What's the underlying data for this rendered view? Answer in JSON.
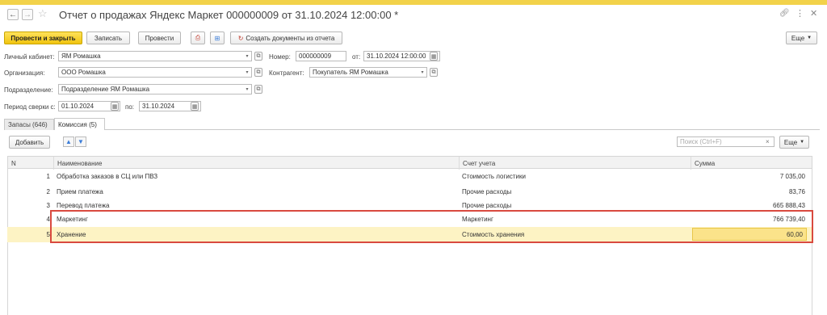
{
  "window": {
    "title": "Отчет о продажах Яндекс Маркет 000000009 от 31.10.2024 12:00:00 *"
  },
  "toolbar": {
    "post_close": "Провести и закрыть",
    "save": "Записать",
    "post": "Провести",
    "create_docs": "Создать документы из отчета",
    "more": "Еще"
  },
  "form": {
    "cabinet_label": "Личный кабинет:",
    "cabinet_value": "ЯМ Ромашка",
    "number_label": "Номер:",
    "number_value": "000000009",
    "date_label": "от:",
    "date_value": "31.10.2024 12:00:00",
    "org_label": "Организация:",
    "org_value": "ООО Ромашка",
    "contractor_label": "Контрагент:",
    "contractor_value": "Покупатель ЯМ Ромашка",
    "division_label": "Подразделение:",
    "division_value": "Подразделение ЯМ Ромашка",
    "period_label": "Период сверки с:",
    "period_from": "01.10.2024",
    "period_to_label": "по:",
    "period_to": "31.10.2024"
  },
  "tabs": [
    {
      "label": "Запасы (646)"
    },
    {
      "label": "Комиссия (5)"
    }
  ],
  "table_toolbar": {
    "add": "Добавить",
    "search_placeholder": "Поиск (Ctrl+F)",
    "more": "Еще"
  },
  "table": {
    "headers": [
      "N",
      "Наименование",
      "Счет учета",
      "Сумма"
    ],
    "rows": [
      {
        "n": "1",
        "name": "Обработка заказов в СЦ или ПВЗ",
        "account": "Стоимость логистики",
        "sum": "7 035,00"
      },
      {
        "n": "2",
        "name": "Прием платежа",
        "account": "Прочие расходы",
        "sum": "83,76"
      },
      {
        "n": "3",
        "name": "Перевод платежа",
        "account": "Прочие расходы",
        "sum": "665 888,43"
      },
      {
        "n": "4",
        "name": "Маркетинг",
        "account": "Маркетинг",
        "sum": "766 739,40"
      },
      {
        "n": "5",
        "name": "Хранение",
        "account": "Стоимость хранения",
        "sum": "60,00"
      }
    ]
  },
  "colors": {
    "accent": "#f1c40f",
    "selected_row": "#fdf3c4",
    "highlight_border": "#d94a3f"
  }
}
